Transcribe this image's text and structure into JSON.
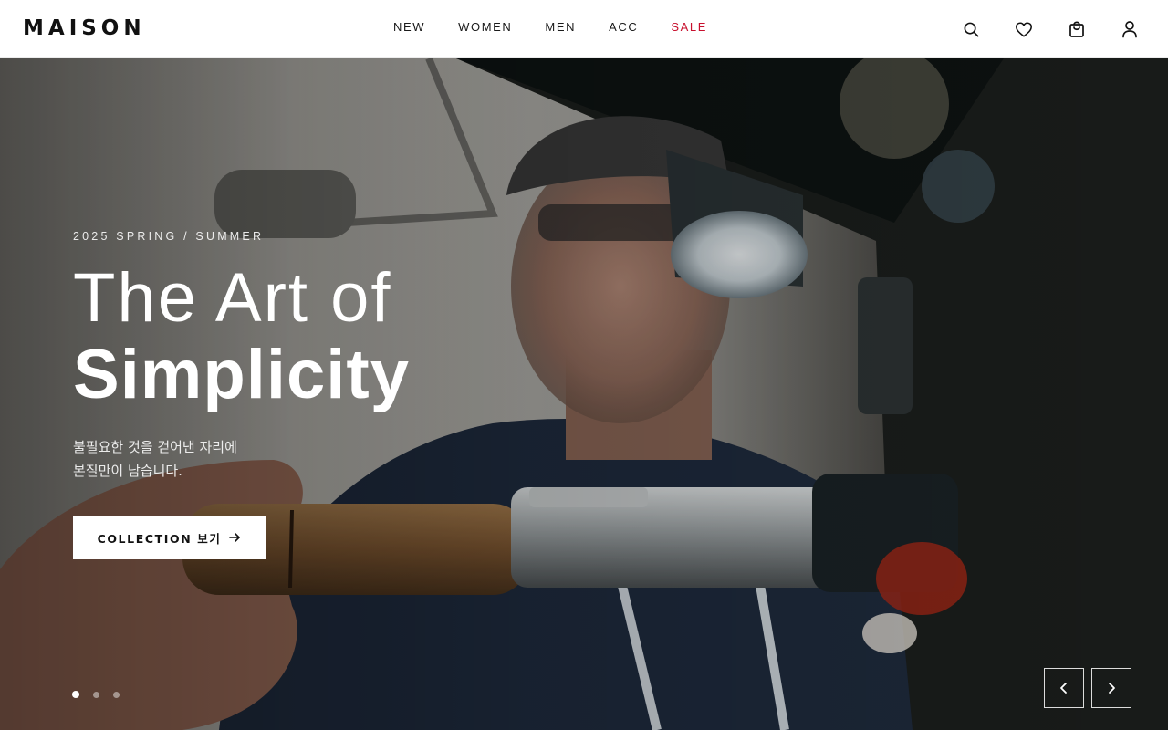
{
  "brand": {
    "logo": "MAISON"
  },
  "nav": {
    "items": [
      {
        "label": "NEW"
      },
      {
        "label": "WOMEN"
      },
      {
        "label": "MEN"
      },
      {
        "label": "ACC"
      },
      {
        "label": "SALE",
        "highlight_color": "#c8102e"
      }
    ]
  },
  "header_icons": [
    "search-icon",
    "heart-icon",
    "shopping-bag-icon",
    "user-icon"
  ],
  "hero": {
    "season": "2025 SPRING / SUMMER",
    "title_line1": "The Art of",
    "title_line2": "Simplicity",
    "description_line1": "불필요한 것을 걷어낸 자리에",
    "description_line2": "본질만이 남습니다.",
    "cta_label": "COLLECTION 보기",
    "cta_icon": "arrow-right-icon"
  },
  "carousel": {
    "slide_count": 3,
    "active_slide": 1,
    "prev_icon": "chevron-left-icon",
    "next_icon": "chevron-right-icon"
  },
  "colors": {
    "accent_sale": "#c8102e",
    "text_primary": "#111111",
    "hero_text": "#ffffff"
  }
}
